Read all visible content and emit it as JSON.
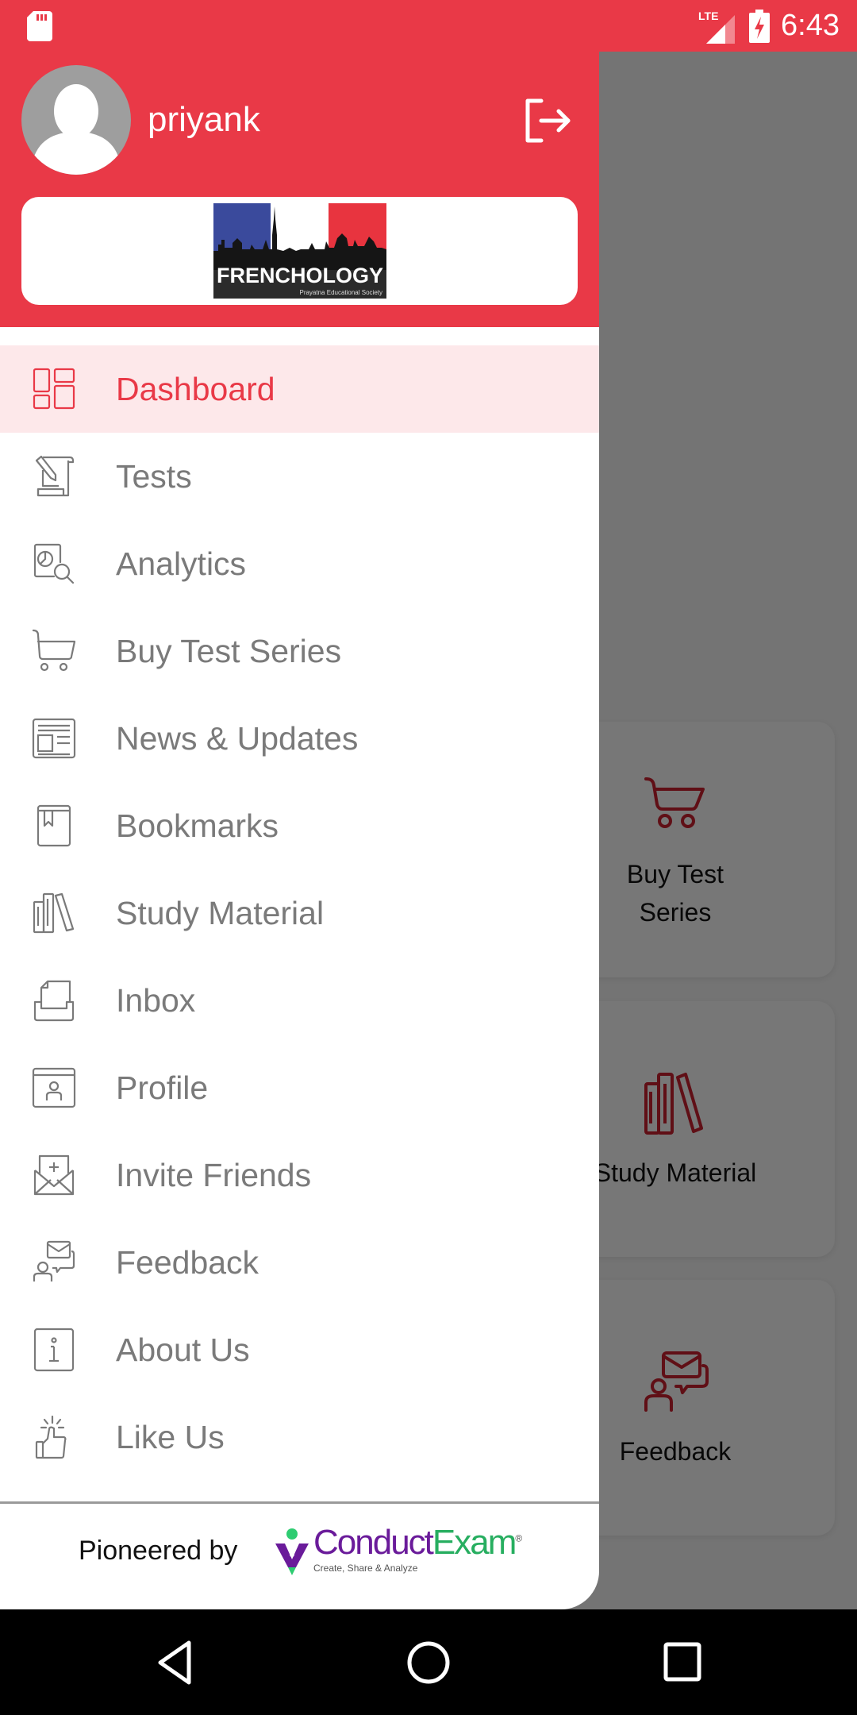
{
  "status_bar": {
    "time": "6:43",
    "network": "LTE",
    "icons": [
      "sd-card-icon",
      "lte-signal-icon",
      "battery-charging-icon"
    ]
  },
  "colors": {
    "brand_red": "#e93947",
    "active_bg": "#fde8ea",
    "menu_text": "#7a7a7a",
    "card_icon": "#a81d28"
  },
  "drawer": {
    "user": {
      "name": "priyank",
      "avatar_icon": "default-avatar-icon",
      "logout_icon": "logout-icon"
    },
    "brand_logo": {
      "title": "FRENCHOLOGY",
      "subtitle": "Prayatna Educational Society"
    },
    "menu": [
      {
        "label": "Dashboard",
        "icon": "dashboard-icon",
        "active": true
      },
      {
        "label": "Tests",
        "icon": "tests-icon",
        "active": false
      },
      {
        "label": "Analytics",
        "icon": "analytics-icon",
        "active": false
      },
      {
        "label": "Buy Test Series",
        "icon": "cart-icon",
        "active": false
      },
      {
        "label": "News & Updates",
        "icon": "newspaper-icon",
        "active": false
      },
      {
        "label": "Bookmarks",
        "icon": "bookmark-icon",
        "active": false
      },
      {
        "label": "Study Material",
        "icon": "books-icon",
        "active": false
      },
      {
        "label": "Inbox",
        "icon": "inbox-icon",
        "active": false
      },
      {
        "label": "Profile",
        "icon": "profile-icon",
        "active": false
      },
      {
        "label": "Invite Friends",
        "icon": "invite-icon",
        "active": false
      },
      {
        "label": "Feedback",
        "icon": "feedback-icon",
        "active": false
      },
      {
        "label": "About Us",
        "icon": "info-icon",
        "active": false
      },
      {
        "label": "Like Us",
        "icon": "thumbs-up-icon",
        "active": false
      }
    ],
    "footer": {
      "pioneered_by": "Pioneered by",
      "partner_name_a": "Conduct",
      "partner_name_b": "Exam",
      "partner_registered": "®",
      "partner_tagline": "Create, Share & Analyze"
    }
  },
  "background_cards": [
    {
      "label": "Buy Test Series",
      "icon": "cart-icon"
    },
    {
      "label": "Study Material",
      "icon": "books-icon"
    },
    {
      "label": "Feedback",
      "icon": "feedback-icon"
    }
  ],
  "nav_bar": {
    "buttons": [
      "back-icon",
      "home-icon",
      "recents-icon"
    ]
  }
}
